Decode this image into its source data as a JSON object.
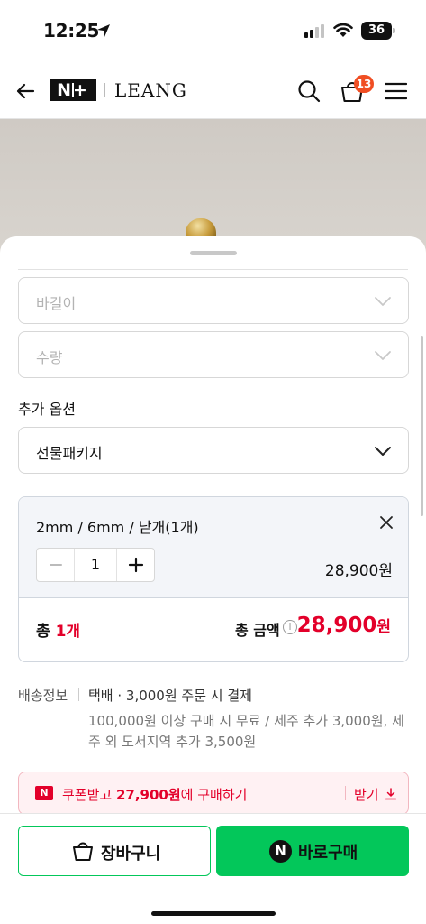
{
  "status_bar": {
    "time": "12:25",
    "battery": "36"
  },
  "header": {
    "brand_badge": "N+",
    "brand_name": "LEANG",
    "cart_count": "13"
  },
  "sheet": {
    "options": [
      {
        "placeholder": "바길이"
      },
      {
        "placeholder": "수량"
      }
    ],
    "additional_label": "추가 옵션",
    "additional_value": "선물패키지",
    "selected_item": {
      "name": "2mm / 6mm / 낱개(1개)",
      "quantity": "1",
      "price": "28,900원"
    },
    "total": {
      "count_prefix": "총 ",
      "count_value": "1개",
      "label": "총 금액",
      "amount": "28,900",
      "unit": "원"
    },
    "shipping": {
      "label": "배송정보",
      "method": "택배 · 3,000원 주문 시 결제",
      "note": "100,000원 이상 구매 시 무료 / 제주 추가 3,000원, 제주 외 도서지역 추가 3,500원"
    },
    "coupon": {
      "text_pre": "쿠폰받고 ",
      "text_amount": "27,900원",
      "text_post": "에 구매하기",
      "receive": "받기"
    }
  },
  "bottom": {
    "cart_label": "장바구니",
    "buy_label": "바로구매"
  },
  "colors": {
    "accent_green": "#03c75a",
    "price_red": "#e3002a",
    "badge_orange": "#f04e23"
  }
}
